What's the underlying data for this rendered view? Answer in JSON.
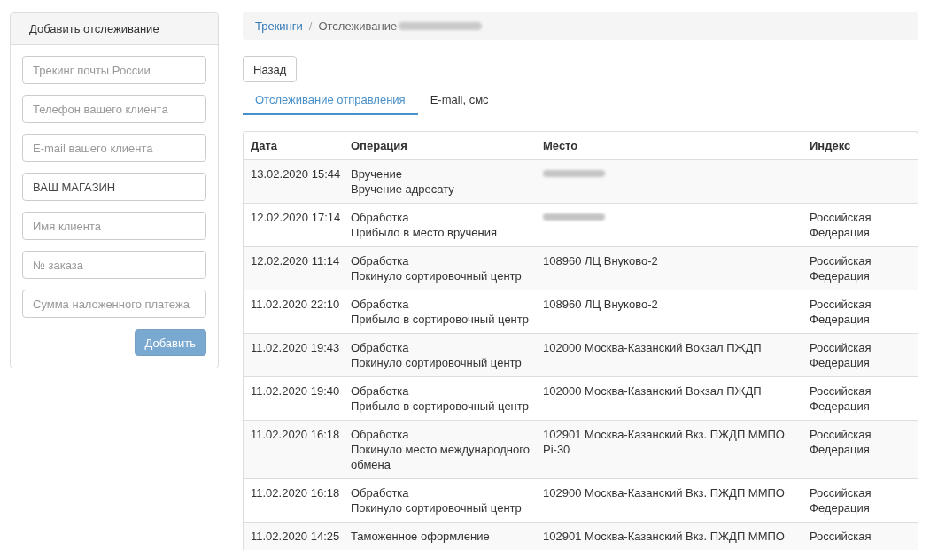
{
  "form": {
    "title": "Добавить отслеживание",
    "fields": [
      {
        "placeholder": "Трекинг почты России"
      },
      {
        "placeholder": "Телефон вашего клиента"
      },
      {
        "placeholder": "E-mail вашего клиента"
      },
      {
        "value": "ВАШ МАГАЗИН"
      },
      {
        "placeholder": "Имя клиента"
      },
      {
        "placeholder": "№ заказа"
      },
      {
        "placeholder": "Сумма наложенного платежа"
      }
    ],
    "submit": {
      "label": "Добавить",
      "disabled": true
    }
  },
  "breadcrumb": {
    "link": "Трекинги",
    "separator": "/",
    "current": "Отслеживание",
    "current_blurred": true
  },
  "back_button": {
    "label": "Назад"
  },
  "tabs": [
    {
      "label": "Отслеживание отправления",
      "selected": true
    },
    {
      "label": "E-mail, смс",
      "selected": false
    }
  ],
  "table": {
    "columns": [
      "Дата",
      "Операция",
      "Место",
      "Индекс"
    ],
    "rows": [
      {
        "date": "13.02.2020 15:44",
        "operation": "Вручение",
        "description": "Вручение адресату",
        "place_blurred": true
      },
      {
        "date": "12.02.2020 17:14",
        "operation": "Обработка",
        "description": "Прибыло в место вручения",
        "place_blurred": true,
        "index": "Российская Федерация"
      },
      {
        "date": "12.02.2020 11:14",
        "operation": "Обработка",
        "description": "Покинуло сортировочный центр",
        "place": "108960 ЛЦ Внуково-2",
        "place_blurred": false,
        "index": "Российская Федерация"
      },
      {
        "date": "11.02.2020 22:10",
        "operation": "Обработка",
        "description": "Прибыло в сортировочный центр",
        "place": "108960 ЛЦ Внуково-2",
        "place_blurred": false,
        "index": "Российская Федерация"
      },
      {
        "date": "11.02.2020 19:43",
        "operation": "Обработка",
        "description": "Покинуло сортировочный центр",
        "place": "102000 Москва-Казанский Вокзал ПЖДП",
        "place_blurred": false,
        "index": "Российская Федерация"
      },
      {
        "date": "11.02.2020 19:40",
        "operation": "Обработка",
        "description": "Прибыло в сортировочный центр",
        "place": "102000 Москва-Казанский Вокзал ПЖДП",
        "place_blurred": false,
        "index": "Российская Федерация"
      },
      {
        "date": "11.02.2020 16:18",
        "operation": "Обработка",
        "description": "Покинуло место международного обмена",
        "place": "102901 Москва-Казанский Вкз. ПЖДП ММПО Pi-30",
        "place_blurred": false,
        "index": "Российская Федерация"
      },
      {
        "date": "11.02.2020 16:18",
        "operation": "Обработка",
        "description": "Покинуло сортировочный центр",
        "place": "102900 Москва-Казанский Вкз. ПЖДП ММПО",
        "place_blurred": false,
        "index": "Российская Федерация"
      },
      {
        "date": "11.02.2020 14:25",
        "operation": "Таможенное оформление",
        "place": "102901 Москва-Казанский Вкз. ПЖДП ММПО",
        "place_blurred": false,
        "index": "Российская"
      }
    ]
  }
}
